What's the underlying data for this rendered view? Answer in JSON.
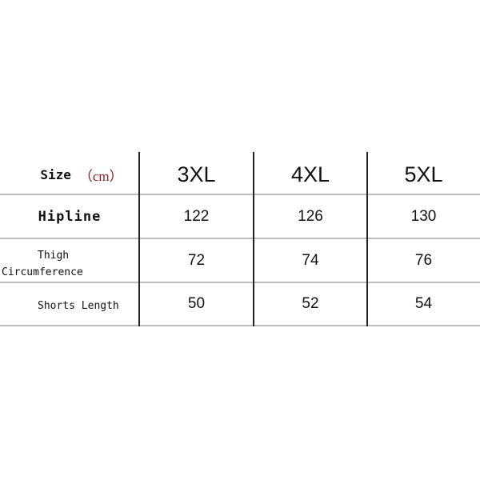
{
  "table": {
    "header": {
      "label": "Size",
      "unit": "（cm）",
      "sizes": [
        "3XL",
        "4XL",
        "5XL"
      ]
    },
    "rows": [
      {
        "label_line1": "Hipline",
        "label_line2": "",
        "values": [
          "122",
          "126",
          "130"
        ]
      },
      {
        "label_line1": "Thigh",
        "label_line2": "Circumference",
        "values": [
          "72",
          "74",
          "76"
        ]
      },
      {
        "label_line1": "Shorts Length",
        "label_line2": "",
        "values": [
          "50",
          "52",
          "54"
        ]
      }
    ]
  },
  "colors": {
    "unit": "#8b1a1a",
    "grid": "#bdbdbd",
    "column_divider": "#222222"
  }
}
